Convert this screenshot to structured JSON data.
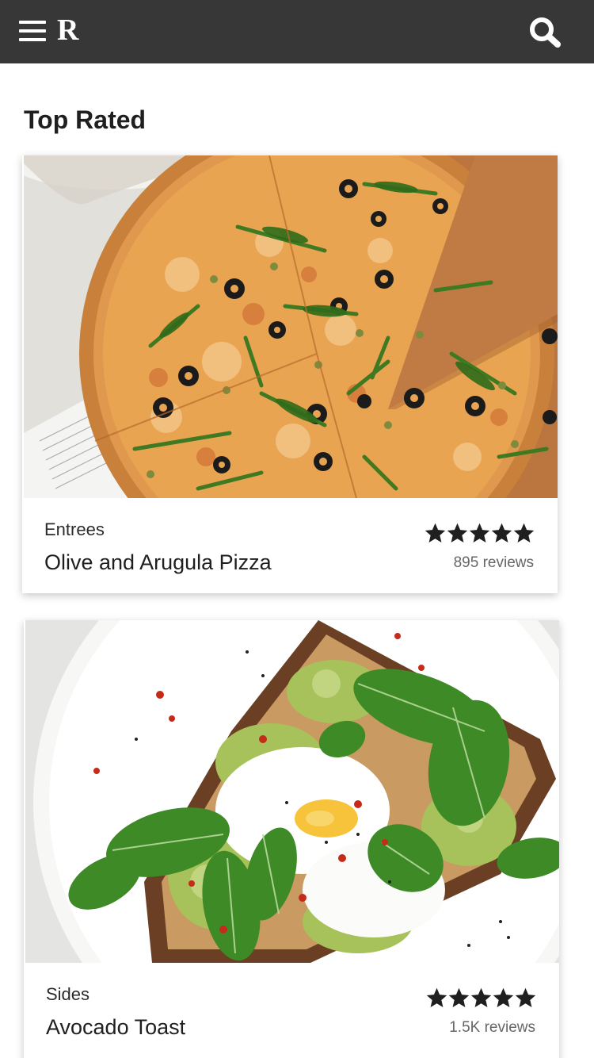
{
  "header": {
    "logo": "R",
    "menu_icon": "hamburger-menu-icon",
    "search_icon": "search-icon",
    "background": "#373737"
  },
  "section": {
    "title": "Top Rated"
  },
  "cards": [
    {
      "category": "Entrees",
      "name": "Olive and Arugula Pizza",
      "rating": 5,
      "reviews": "895 reviews",
      "photo": "olive-arugula-pizza-photo"
    },
    {
      "category": "Sides",
      "name": "Avocado Toast",
      "rating": 5,
      "reviews": "1.5K reviews",
      "photo": "avocado-toast-photo"
    }
  ]
}
